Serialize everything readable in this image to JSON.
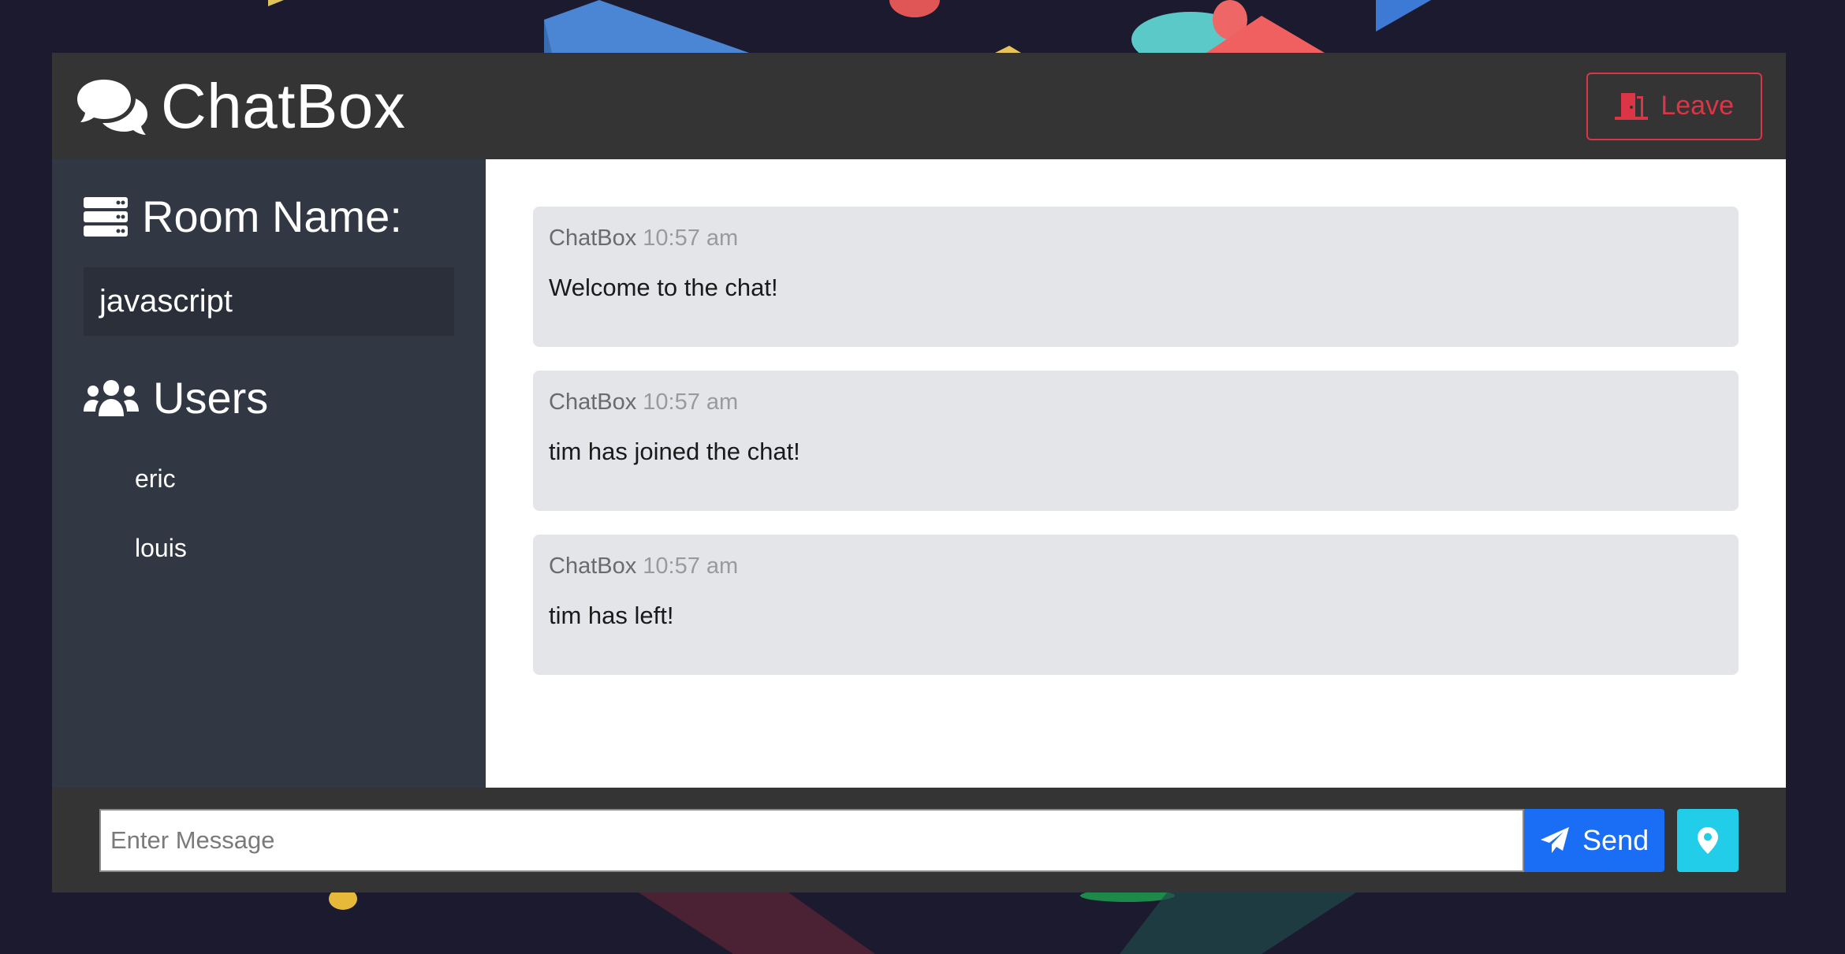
{
  "header": {
    "title": "ChatBox",
    "leave_label": "Leave"
  },
  "sidebar": {
    "room_heading": "Room Name:",
    "room_name": "javascript",
    "users_heading": "Users",
    "users": [
      "eric",
      "louis"
    ]
  },
  "messages": [
    {
      "author": "ChatBox",
      "time": "10:57 am",
      "text": "Welcome to the chat!"
    },
    {
      "author": "ChatBox",
      "time": "10:57 am",
      "text": "tim has joined the chat!"
    },
    {
      "author": "ChatBox",
      "time": "10:57 am",
      "text": "tim has left!"
    }
  ],
  "composer": {
    "placeholder": "Enter Message",
    "send_label": "Send"
  },
  "colors": {
    "background": "#1c1a2e",
    "header": "#343434",
    "sidebar": "#323744",
    "danger": "#dc3545",
    "primary": "#1a6ef5",
    "info": "#22cdea"
  }
}
